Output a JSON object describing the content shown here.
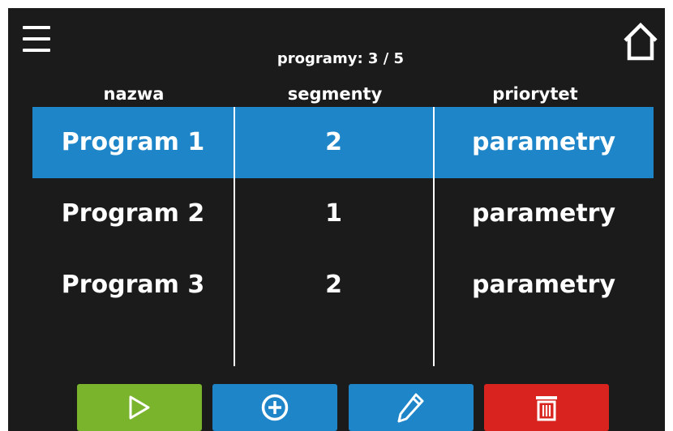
{
  "header": {
    "menu_icon": "hamburger-menu-icon",
    "home_icon": "home-icon",
    "counter_text": "programy: 3 / 5"
  },
  "table": {
    "columns": [
      "nazwa",
      "segmenty",
      "priorytet"
    ],
    "rows": [
      {
        "name": "Program 1",
        "segments": "2",
        "priority": "parametry",
        "selected": true
      },
      {
        "name": "Program 2",
        "segments": "1",
        "priority": "parametry",
        "selected": false
      },
      {
        "name": "Program 3",
        "segments": "2",
        "priority": "parametry",
        "selected": false
      }
    ]
  },
  "toolbar": {
    "buttons": [
      {
        "name": "play",
        "icon": "play-icon",
        "color": "#7ab42d"
      },
      {
        "name": "add",
        "icon": "plus-circle-icon",
        "color": "#1d85c8"
      },
      {
        "name": "edit",
        "icon": "pencil-icon",
        "color": "#1d85c8"
      },
      {
        "name": "delete",
        "icon": "trash-icon",
        "color": "#d8231e"
      }
    ]
  },
  "colors": {
    "background": "#1b1b1b",
    "selection": "#1d85c8",
    "text": "#ffffff"
  }
}
